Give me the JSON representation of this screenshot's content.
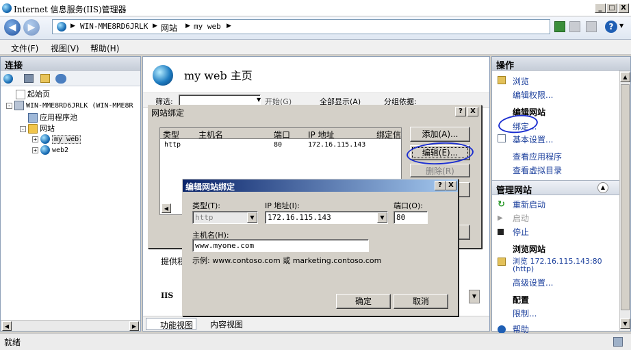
{
  "window": {
    "title": "Internet 信息服务(IIS)管理器",
    "min": "_",
    "max": "□",
    "close": "X"
  },
  "address": {
    "crumbs": [
      "WIN-MME8RD6JRLK",
      "网站",
      "my web"
    ]
  },
  "menu": [
    "文件(F)",
    "视图(V)",
    "帮助(H)"
  ],
  "left": {
    "header": "连接",
    "tree": [
      "起始页",
      "WIN-MME8RD6JRLK (WIN-MME8R",
      "应用程序池",
      "网站",
      "my web",
      "web2"
    ]
  },
  "center": {
    "title": "my web 主页",
    "filter_label": "筛选:",
    "start": "开始(G)",
    "show_all": "全部显示(A)",
    "group_by": "分组依据:",
    "partial_1": "提供程",
    "partial_2": "IIS",
    "tab_feature": "功能视图",
    "tab_content": "内容视图"
  },
  "bindings_dialog": {
    "title": "网站绑定",
    "help": "?",
    "close": "X",
    "columns": [
      "类型",
      "主机名",
      "端口",
      "IP 地址",
      "绑定信"
    ],
    "rows": [
      {
        "type": "http",
        "host": "",
        "port": "80",
        "ip": "172.16.115.143"
      }
    ],
    "add": "添加(A)...",
    "edit": "编辑(E)...",
    "remove": "删除(R)"
  },
  "edit_dialog": {
    "title": "编辑网站绑定",
    "help": "?",
    "close": "X",
    "type_label": "类型(T):",
    "type_value": "http",
    "ip_label": "IP 地址(I):",
    "ip_value": "172.16.115.143",
    "port_label": "端口(O):",
    "port_value": "80",
    "host_label": "主机名(H):",
    "host_value": "www.myone.com",
    "example": "示例: www.contoso.com 或 marketing.contoso.com",
    "ok": "确定",
    "cancel": "取消"
  },
  "right": {
    "header": "操作",
    "items": [
      "浏览",
      "编辑权限...",
      "编辑网站",
      "绑定...",
      "基本设置...",
      "查看应用程序",
      "查看虚拟目录"
    ],
    "manage_header": "管理网站",
    "manage_items": [
      "重新启动",
      "启动",
      "停止",
      "浏览网站",
      "浏览 172.16.115.143:80",
      "(http)",
      "高级设置...",
      "配置",
      "限制...",
      "帮助"
    ]
  },
  "status": {
    "text": "就绪"
  },
  "colors": {
    "dialog_title": "#0a246a",
    "ink": "#1c2fd0"
  }
}
